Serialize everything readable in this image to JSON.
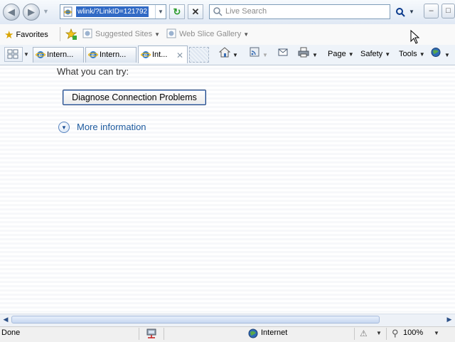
{
  "browser": {
    "address_url": "wlink/?LinkID=121792",
    "search_placeholder": "Live Search"
  },
  "favorites_bar": {
    "favorites_label": "Favorites",
    "links": [
      {
        "label": "Suggested Sites"
      },
      {
        "label": "Web Slice Gallery"
      }
    ]
  },
  "tabs": [
    {
      "label": "Intern..."
    },
    {
      "label": "Intern..."
    },
    {
      "label": "Int...",
      "active": true
    }
  ],
  "command_bar": {
    "page_label": "Page",
    "safety_label": "Safety",
    "tools_label": "Tools"
  },
  "content": {
    "try_heading": "What you can try:",
    "diagnose_button": "Diagnose Connection Problems",
    "more_info_link": "More information"
  },
  "status_bar": {
    "status_text": "Done",
    "zone_text": "Internet",
    "zoom_text": "100%"
  },
  "icons": [
    "back-icon",
    "forward-icon",
    "page-icon",
    "refresh-icon",
    "stop-icon",
    "search-icon",
    "minimize-icon",
    "maximize-icon",
    "favorites-star-icon",
    "add-favorite-icon",
    "ie-icon",
    "quick-tabs-icon",
    "home-icon",
    "feeds-icon",
    "mail-icon",
    "print-icon",
    "research-icon",
    "expand-icon",
    "network-icon",
    "globe-icon",
    "protected-mode-icon",
    "zoom-icon",
    "mouse-cursor-icon"
  ],
  "colors": {
    "selection": "#316ac5",
    "link": "#1d5a9e",
    "nav_gradient_top": "#f7fafd",
    "nav_gradient_bottom": "#dfe8f4"
  }
}
